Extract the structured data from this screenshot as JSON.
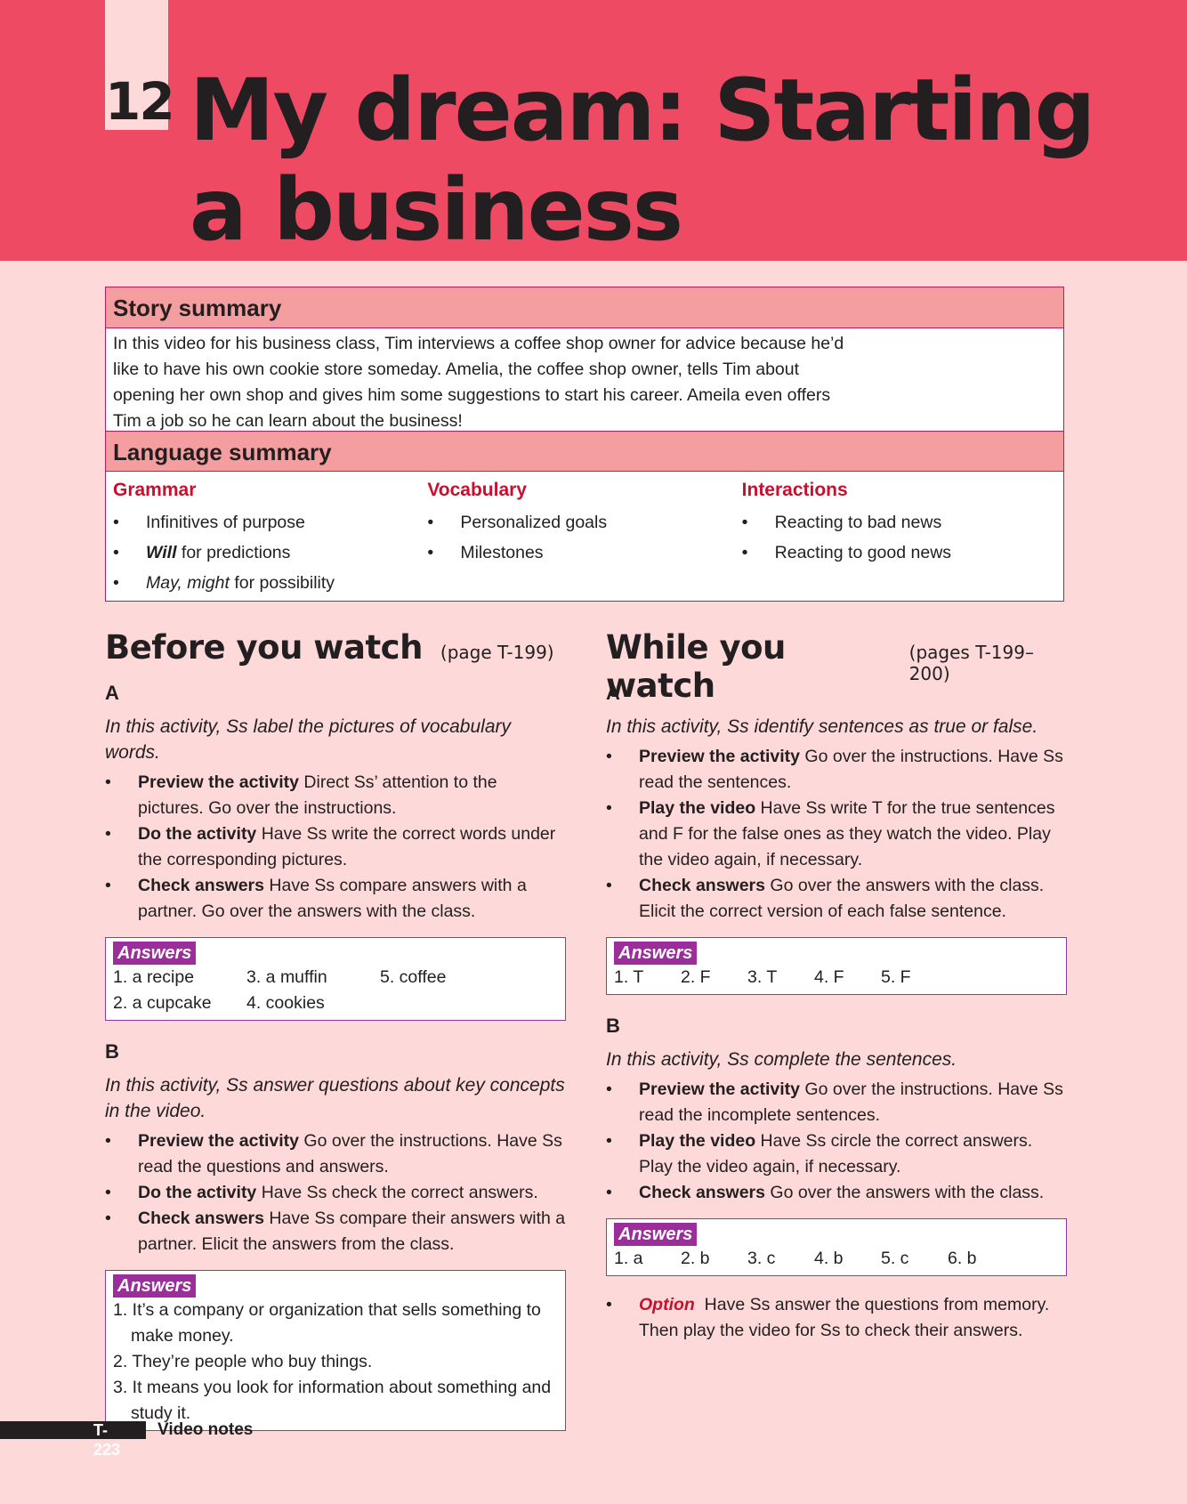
{
  "header": {
    "unit_number": "12",
    "title": "My dream: Starting a business"
  },
  "story_summary": {
    "heading": "Story summary",
    "text": "In this video for his business class, Tim interviews a coffee shop owner for advice because he’d like to have his own cookie store someday. Amelia, the coffee shop owner, tells Tim about opening her own shop and gives him some suggestions to start his career. Ameila even offers Tim a job so he can learn about the business!"
  },
  "language_summary": {
    "heading": "Language summary",
    "columns": [
      {
        "title": "Grammar",
        "items": [
          {
            "pre": "",
            "em": "",
            "text": "Infinitives of purpose"
          },
          {
            "pre": "Will",
            "em": "",
            "text": " for predictions"
          },
          {
            "pre": "",
            "em": "May, might",
            "text": " for possibility"
          }
        ]
      },
      {
        "title": "Vocabulary",
        "items": [
          {
            "text": "Personalized goals"
          },
          {
            "text": "Milestones"
          }
        ]
      },
      {
        "title": "Interactions",
        "items": [
          {
            "text": "Reacting to bad news"
          },
          {
            "text": "Reacting to good news"
          }
        ]
      }
    ]
  },
  "before": {
    "title": "Before you watch",
    "page": "(page T-199)",
    "a": {
      "letter": "A",
      "intro": "In this activity, Ss label the pictures of vocabulary words.",
      "steps": [
        {
          "label": "Preview the activity",
          "text": " Direct Ss’ attention to the pictures. Go over the instructions."
        },
        {
          "label": "Do the activity",
          "text": " Have Ss write the correct words under the corresponding pictures."
        },
        {
          "label": "Check answers",
          "text": " Have Ss compare answers with a partner. Go over the answers with the class."
        }
      ],
      "answers_label": "Answers",
      "answers": [
        "1. a recipe",
        "3. a muffin",
        "5. coffee",
        "2. a cupcake",
        "4. cookies",
        ""
      ]
    },
    "b": {
      "letter": "B",
      "intro": "In this activity, Ss answer questions about key concepts in the video.",
      "steps": [
        {
          "label": "Preview the activity",
          "text": " Go over the instructions. Have Ss read the questions and answers."
        },
        {
          "label": "Do the activity",
          "text": " Have Ss check the correct answers."
        },
        {
          "label": "Check answers",
          "text": " Have Ss compare their answers with a partner. Elicit the answers from the class."
        }
      ],
      "answers_label": "Answers",
      "answers": [
        "1. It’s a company or organization that sells something to make money.",
        "2. They’re people who buy things.",
        "3. It means you look for information about something and study it."
      ]
    }
  },
  "while": {
    "title": "While you watch",
    "page": "(pages T-199–200)",
    "a": {
      "letter": "A",
      "intro": "In this activity, Ss identify sentences as true or false.",
      "steps": [
        {
          "label": "Preview the activity",
          "text": " Go over the instructions. Have Ss read the sentences."
        },
        {
          "label": "Play the video",
          "text": " Have Ss write T for the true sentences and F for the false ones as they watch the video. Play the video again, if necessary."
        },
        {
          "label": "Check answers",
          "text": " Go over the answers with the class. Elicit the correct version of each false sentence."
        }
      ],
      "answers_label": "Answers",
      "answers": [
        "1. T",
        "2. F",
        "3. T",
        "4. F",
        "5. F"
      ]
    },
    "b": {
      "letter": "B",
      "intro": "In this activity, Ss complete the sentences.",
      "steps": [
        {
          "label": "Preview the activity",
          "text": " Go over the instructions. Have Ss read the incomplete sentences."
        },
        {
          "label": "Play the video",
          "text": " Have Ss circle the correct answers. Play the video again, if necessary."
        },
        {
          "label": "Check answers",
          "text": " Go over the answers with the class."
        }
      ],
      "answers_label": "Answers",
      "answers": [
        "1. a",
        "2. b",
        "3. c",
        "4. b",
        "5. c",
        "6. b"
      ],
      "option_label": "Option",
      "option_text": "  Have Ss answer the questions from memory. Then play the video for Ss to check their answers."
    }
  },
  "footer": {
    "page": "T-223",
    "label": "Video notes"
  }
}
